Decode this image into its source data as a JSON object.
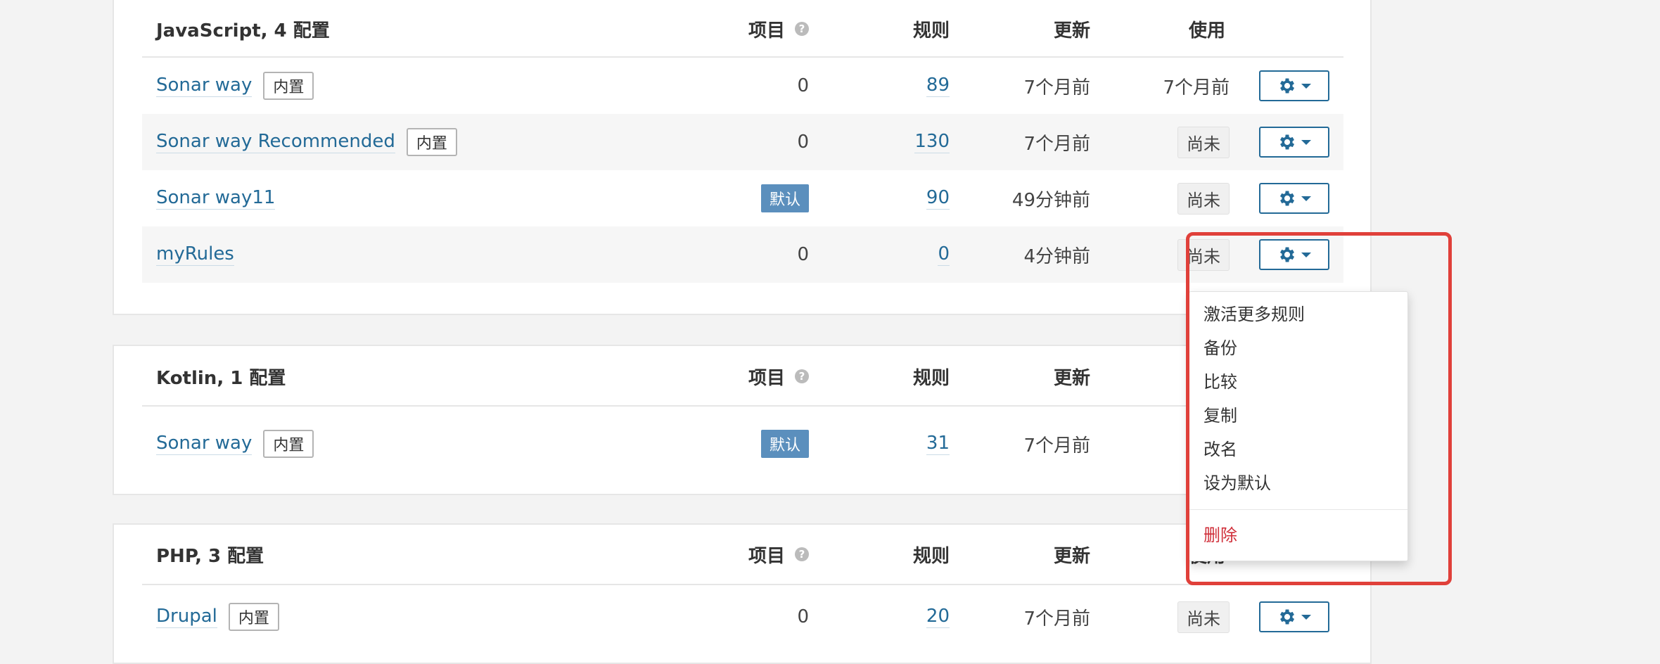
{
  "headers": {
    "projects": "项目",
    "rules": "规则",
    "updated": "更新",
    "used": "使用"
  },
  "sections": [
    {
      "title": "JavaScript, 4 配置",
      "rows": [
        {
          "name": "Sonar way",
          "builtin": "内置",
          "projects": "0",
          "rules": "89",
          "updated": "7个月前",
          "used": "7个月前"
        },
        {
          "name": "Sonar way Recommended",
          "builtin": "内置",
          "projects": "0",
          "rules": "130",
          "updated": "7个月前",
          "used": "尚未"
        },
        {
          "name": "Sonar way11",
          "default": "默认",
          "rules": "90",
          "updated": "49分钟前",
          "used": "尚未"
        },
        {
          "name": "myRules",
          "projects": "0",
          "rules": "0",
          "updated": "4分钟前",
          "used": "尚未"
        }
      ]
    },
    {
      "title": "Kotlin, 1 配置",
      "rows": [
        {
          "name": "Sonar way",
          "builtin": "内置",
          "default": "默认",
          "rules": "31",
          "updated": "7个月前"
        }
      ]
    },
    {
      "title": "PHP, 3 配置",
      "rows": [
        {
          "name": "Drupal",
          "builtin": "内置",
          "projects": "0",
          "rules": "20",
          "updated": "7个月前",
          "used": "尚未"
        }
      ]
    }
  ],
  "menu": {
    "items": [
      "激活更多规则",
      "备份",
      "比较",
      "复制",
      "改名",
      "设为默认"
    ],
    "delete": "删除"
  },
  "colors": {
    "link": "#236a97",
    "highlight": "#e0403a",
    "danger": "#d02f3a",
    "default_badge": "#5b8fbd"
  }
}
